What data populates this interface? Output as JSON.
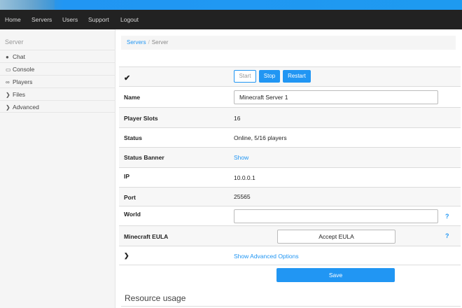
{
  "nav": {
    "items": [
      "Home",
      "Servers",
      "Users",
      "Support",
      "Logout"
    ]
  },
  "sidebar": {
    "title": "Server",
    "items": [
      {
        "label": "Chat",
        "icon": "chat-icon"
      },
      {
        "label": "Console",
        "icon": "console-icon"
      },
      {
        "label": "Players",
        "icon": "players-icon"
      },
      {
        "label": "Files",
        "icon": "chevron-right-icon"
      },
      {
        "label": "Advanced",
        "icon": "chevron-right-icon"
      }
    ]
  },
  "breadcrumb": {
    "link": "Servers",
    "separator": "/",
    "current": "Server"
  },
  "controls": {
    "start": "Start",
    "stop": "Stop",
    "restart": "Restart"
  },
  "fields": {
    "name_label": "Name",
    "name_value": "Minecraft Server 1",
    "slots_label": "Player Slots",
    "slots_value": "16",
    "status_label": "Status",
    "status_value": "Online, 5/16 players",
    "banner_label": "Status Banner",
    "banner_link": "Show",
    "ip_label": "IP",
    "ip_value": "10.0.0.1",
    "port_label": "Port",
    "port_value": "25565",
    "world_label": "World",
    "world_value": "",
    "eula_label": "Minecraft EULA",
    "eula_button": "Accept EULA",
    "help": "?",
    "advanced_link": "Show Advanced Options",
    "save": "Save"
  },
  "section": {
    "resource_usage": "Resource usage"
  },
  "colors": {
    "accent": "#2196f3",
    "navbar": "#222222",
    "sidebar": "#f5f5f5"
  }
}
